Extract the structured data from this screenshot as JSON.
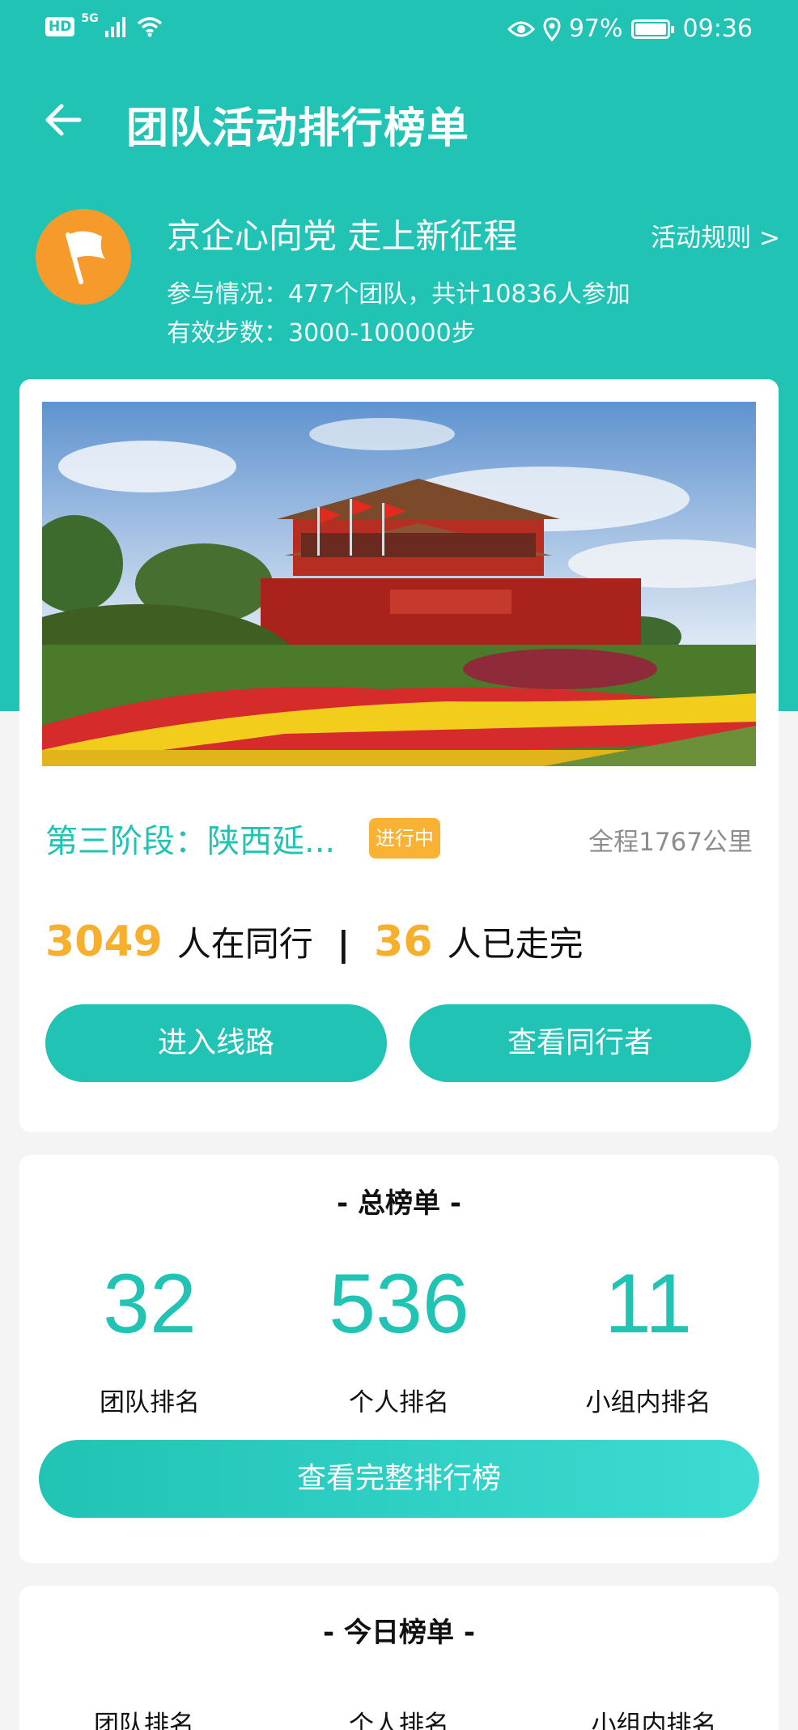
{
  "status_bar": {
    "network": "HD",
    "signal": "5G",
    "battery": "97%",
    "time": "09:36"
  },
  "header": {
    "title": "团队活动排行榜单"
  },
  "activity": {
    "name": "京企心向党 走上新征程",
    "rules_link": "活动规则 >",
    "participation": "参与情况：477个团队，共计10836人参加",
    "steps": "有效步数：3000-100000步"
  },
  "stage": {
    "title": "第三阶段：陕西延...",
    "status": "进行中",
    "distance": "全程1767公里",
    "walking_count": "3049",
    "walking_label": "人在同行",
    "separator": "|",
    "finished_count": "36",
    "finished_label": "人已走完",
    "enter_route_label": "进入线路",
    "view_companions_label": "查看同行者"
  },
  "overall_ranking": {
    "title": "- 总榜单 -",
    "items": [
      {
        "value": "32",
        "label": "团队排名"
      },
      {
        "value": "536",
        "label": "个人排名"
      },
      {
        "value": "11",
        "label": "小组内排名"
      }
    ],
    "view_full_label": "查看完整排行榜"
  },
  "today_ranking": {
    "title": "- 今日榜单 -",
    "labels": [
      "团队排名",
      "个人排名",
      "小组内排名"
    ]
  },
  "colors": {
    "primary": "#21c3b4",
    "accent": "#f7b02e",
    "logo": "#f79a2c"
  }
}
